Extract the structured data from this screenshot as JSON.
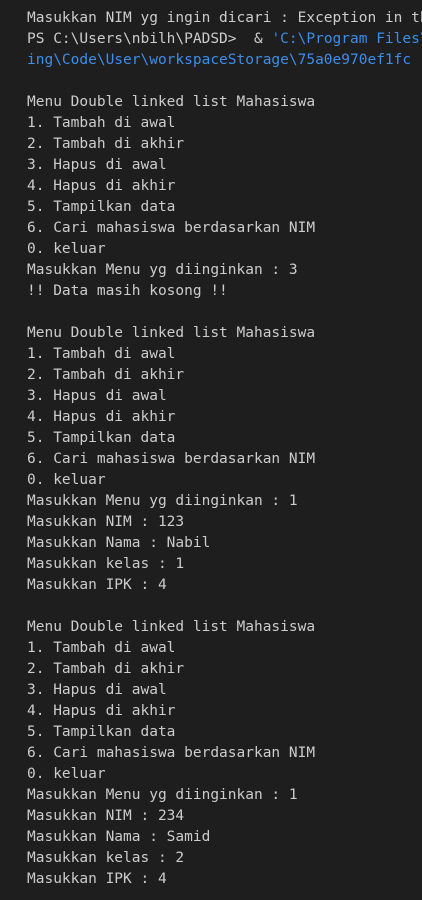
{
  "terminal": {
    "colors": {
      "background": "#1e1e1e",
      "text": "#cccccc",
      "path": "#3b8eea"
    },
    "header": {
      "line1": "Masukkan NIM yg ingin dicari : Exception in thread",
      "line2_prefix": "PS C:\\Users\\nbilh\\PADSD>  & ",
      "line2_path": "'C:\\Program Files\\Java\\jdk",
      "line3_path": "ing\\Code\\User\\workspaceStorage\\75a0e970ef1fc"
    },
    "menu": {
      "title": "Menu Double linked list Mahasiswa",
      "items": [
        "1. Tambah di awal",
        "2. Tambah di akhir",
        "3. Hapus di awal",
        "4. Hapus di akhir",
        "5. Tampilkan data",
        "6. Cari mahasiswa berdasarkan NIM",
        "0. keluar"
      ]
    },
    "session1": {
      "choice": "Masukkan Menu yg diinginkan : 3",
      "message": "!! Data masih kosong !!"
    },
    "session2": {
      "choice": "Masukkan Menu yg diinginkan : 1",
      "nim": "Masukkan NIM : 123",
      "nama": "Masukkan Nama : Nabil",
      "kelas": "Masukkan kelas : 1",
      "ipk": "Masukkan IPK : 4"
    },
    "session3": {
      "choice": "Masukkan Menu yg diinginkan : 1",
      "nim": "Masukkan NIM : 234",
      "nama": "Masukkan Nama : Samid",
      "kelas": "Masukkan kelas : 2",
      "ipk": "Masukkan IPK : 4"
    }
  }
}
